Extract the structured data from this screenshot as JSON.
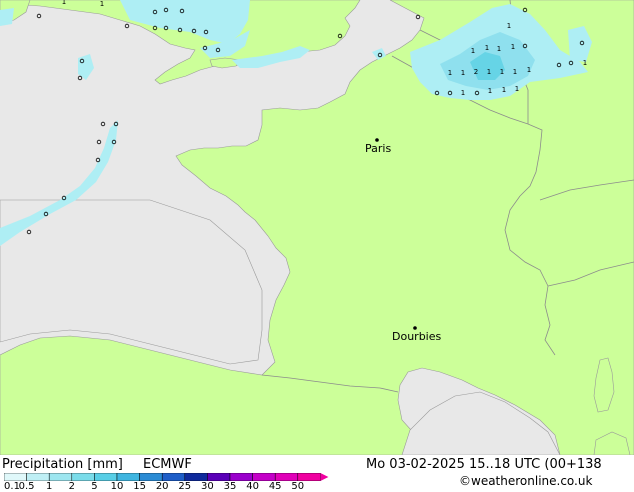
{
  "colors": {
    "sea": "#e8e8e8",
    "land": "#ccff99",
    "border": "#8c8c8c",
    "coast": "#9a9a9a",
    "precip_light": "#aeeef4",
    "precip_mid": "#8fe0ee",
    "precip_strong": "#66d4e6"
  },
  "map": {
    "cities": [
      {
        "id": "paris",
        "name": "Paris"
      },
      {
        "id": "dourbies",
        "name": "Dourbies"
      }
    ],
    "precip_values": [
      "0",
      "1",
      "2"
    ]
  },
  "legend": {
    "title": "Precipitation [mm]",
    "model": "ECMWF",
    "ticks": [
      "0.1",
      "0.5",
      "1",
      "2",
      "5",
      "10",
      "15",
      "20",
      "25",
      "30",
      "35",
      "40",
      "45",
      "50"
    ],
    "colors": [
      "#e0f8fa",
      "#bfeff5",
      "#9de6f0",
      "#7adcea",
      "#58cee6",
      "#3fb5e0",
      "#2b8bd4",
      "#1e5ec8",
      "#0f2a9c",
      "#5a00b8",
      "#9a00cc",
      "#c400c8",
      "#e000b8",
      "#f000a0"
    ]
  },
  "valid_time": "Mo 03-02-2025 15..18 UTC (00+138",
  "credit": "©weatheronline.co.uk"
}
